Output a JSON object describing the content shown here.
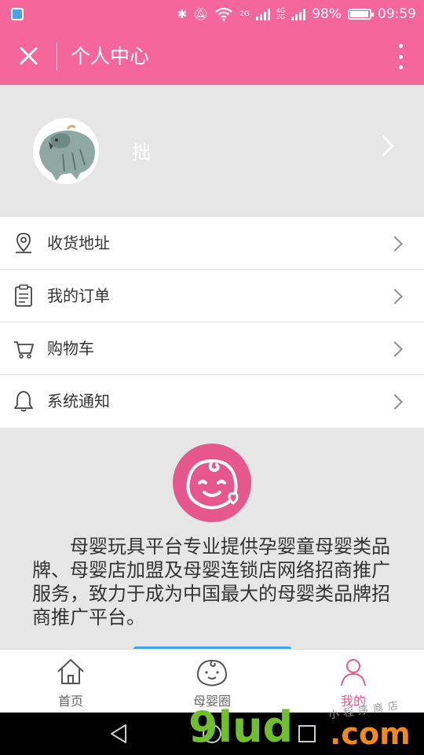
{
  "status_bar": {
    "signal_type": "2G",
    "signal_type_2": "4G\n2G",
    "battery": "98%",
    "time": "09:59"
  },
  "title_bar": {
    "title": "个人中心"
  },
  "profile": {
    "username": "拙"
  },
  "menu": {
    "items": [
      {
        "label": "收货地址",
        "icon": "location-pin-icon"
      },
      {
        "label": "我的订单",
        "icon": "clipboard-icon"
      },
      {
        "label": "购物车",
        "icon": "cart-icon"
      },
      {
        "label": "系统通知",
        "icon": "bell-icon"
      }
    ]
  },
  "about": {
    "text": "母婴玩具平台专业提供孕婴童母婴类品牌、母婴店加盟及母婴连锁店网络招商推广服务，致力于成为中国最大的母婴类品牌招商推广平台。"
  },
  "tabs": [
    {
      "label": "首页",
      "icon": "home-icon",
      "active": false
    },
    {
      "label": "母婴圈",
      "icon": "baby-face-icon",
      "active": false
    },
    {
      "label": "我的",
      "icon": "person-icon",
      "active": true
    }
  ],
  "watermark": {
    "big": "9lud",
    "com": ".com",
    "small": "小程序商店"
  },
  "colors": {
    "brand_pink": "#f5669a",
    "logo_pink": "#e6588b",
    "active_tab": "#e6588b"
  }
}
